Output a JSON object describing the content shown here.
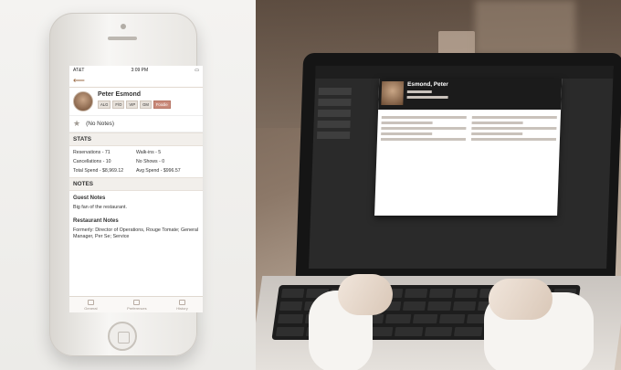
{
  "phone": {
    "carrier": "AT&T",
    "time": "3:09 PM",
    "guest_name": "Peter Esmond",
    "tags": [
      "ALG",
      "F/O",
      "VIP",
      "GM",
      "Foodie"
    ],
    "notes_placeholder": "(No Notes)",
    "stats_title": "STATS",
    "stats": [
      {
        "label": "Reservations - 71"
      },
      {
        "label": "Walk-ins - 5"
      },
      {
        "label": "Cancellations - 10"
      },
      {
        "label": "No Shows - 0"
      },
      {
        "label": "Total Spend - $8,969.12"
      },
      {
        "label": "Avg Spend - $996.57"
      }
    ],
    "notes_title": "NOTES",
    "guest_notes_title": "Guest Notes",
    "guest_notes_text": "Big fan of the restaurant.",
    "restaurant_notes_title": "Restaurant Notes",
    "restaurant_notes_text": "Formerly: Director of Operations, Rouge Tomate; General Manager, Per Se; Service",
    "tabs": [
      "General",
      "Preferences",
      "History"
    ]
  },
  "laptop": {
    "card_name": "Esmond, Peter"
  }
}
